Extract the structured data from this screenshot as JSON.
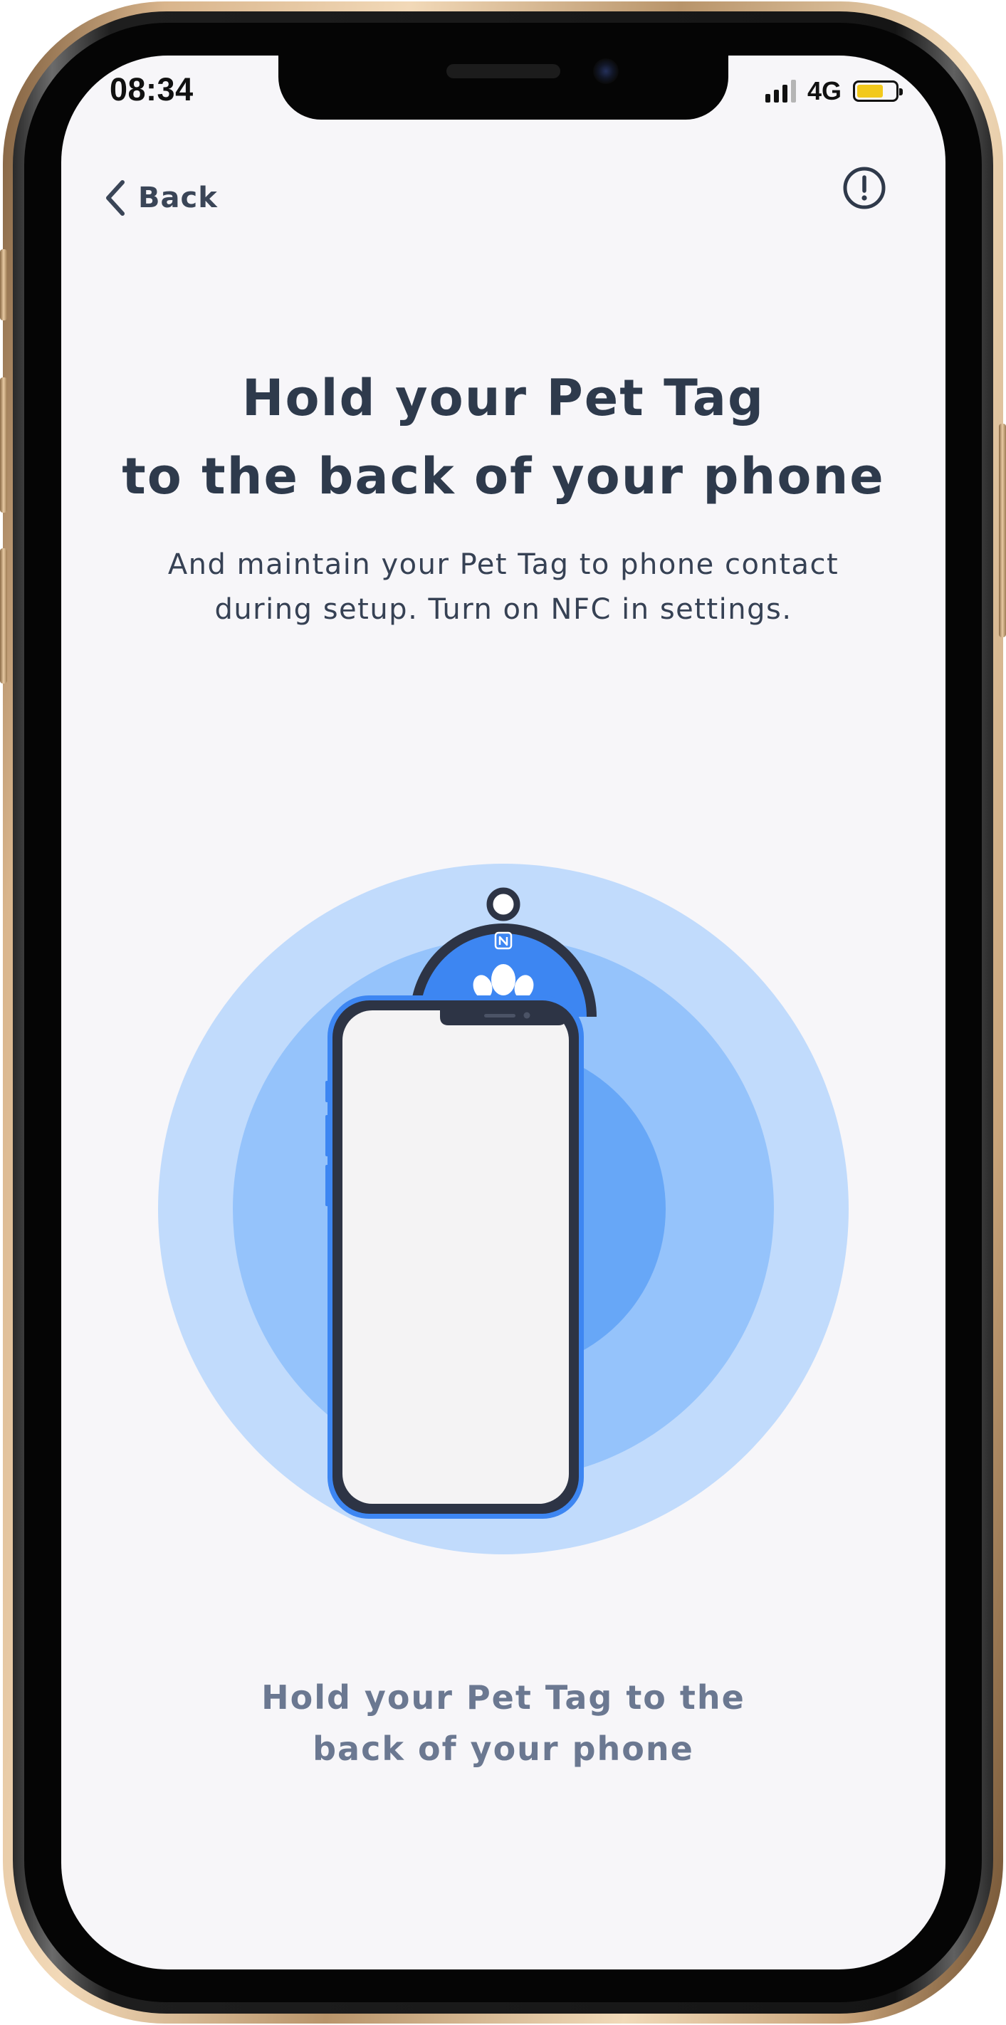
{
  "status_bar": {
    "time": "08:34",
    "network": "4G",
    "signal_icon": "cellular-signal-icon",
    "battery_icon": "battery-icon",
    "battery_color": "#f2c91c"
  },
  "nav": {
    "back_label": "Back",
    "back_icon": "chevron-left-icon",
    "info_icon": "exclamation-circle-icon"
  },
  "header": {
    "title_line_1": "Hold your Pet Tag",
    "title_line_2": "to the back of your phone",
    "subtitle_line_1": "And maintain your Pet Tag to phone contact",
    "subtitle_line_2": "during setup. Turn on NFC in settings."
  },
  "illustration": {
    "tag_icon": "nfc-icon",
    "paw_icon": "paw-print-icon",
    "phone_icon": "smartphone-icon",
    "colors": {
      "ring_outer": "#c1dbfc",
      "ring_middle": "#95c3fb",
      "ring_inner": "#67a7f7",
      "tag_blue": "#3d86f2",
      "outline": "#2d3445"
    }
  },
  "footer": {
    "caption_line_1": "Hold your Pet Tag to the",
    "caption_line_2": "back of your phone"
  }
}
